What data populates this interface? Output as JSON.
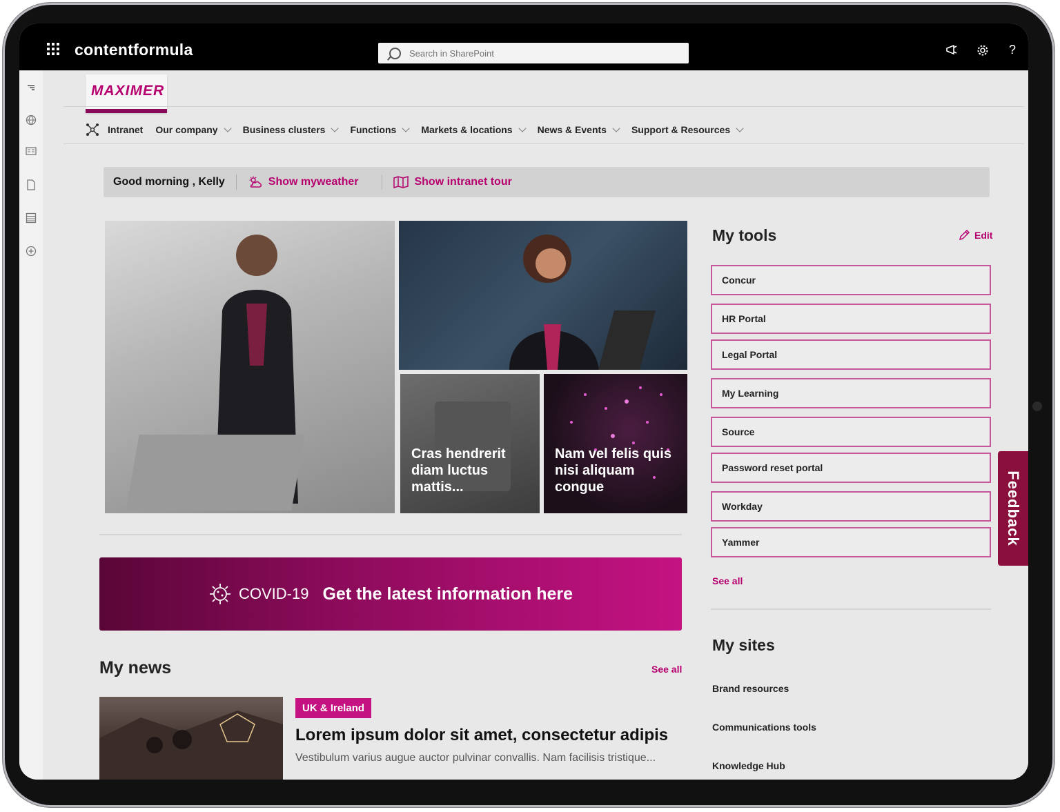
{
  "suitebar": {
    "brand": "contentformula",
    "search_placeholder": "Search in SharePoint"
  },
  "logo": {
    "text": "MAXIMER"
  },
  "nav": {
    "items": [
      {
        "label": "Intranet"
      },
      {
        "label": "Our company"
      },
      {
        "label": "Business clusters"
      },
      {
        "label": "Functions"
      },
      {
        "label": "Markets & locations"
      },
      {
        "label": "News & Events"
      },
      {
        "label": "Support & Resources"
      }
    ]
  },
  "greeting": {
    "text": "Good morning , Kelly",
    "weather_link": "Show myweather",
    "tour_link": "Show intranet tour"
  },
  "hero": {
    "tiles": [
      {
        "caption": ""
      },
      {
        "caption": ""
      },
      {
        "caption": "Cras hendrerit diam luctus mattis..."
      },
      {
        "caption": "Nam vel felis quis nisi aliquam congue"
      }
    ]
  },
  "covid": {
    "tag": "COVID-19",
    "text": "Get the latest information here"
  },
  "news": {
    "title": "My news",
    "see_all": "See all",
    "items": [
      {
        "tag": "UK & Ireland",
        "headline": "Lorem ipsum dolor sit amet, consectetur adipis",
        "excerpt": "Vestibulum varius augue auctor pulvinar convallis. Nam facilisis tristique..."
      }
    ]
  },
  "tools": {
    "title": "My tools",
    "edit_label": "Edit",
    "items": [
      {
        "label": "Concur"
      },
      {
        "label": "HR Portal"
      },
      {
        "label": "Legal Portal"
      },
      {
        "label": "My Learning"
      },
      {
        "label": "Source"
      },
      {
        "label": "Password reset portal"
      },
      {
        "label": "Workday"
      },
      {
        "label": "Yammer"
      }
    ],
    "see_all": "See all"
  },
  "sites": {
    "title": "My sites",
    "items": [
      {
        "label": "Brand resources"
      },
      {
        "label": "Communications tools"
      },
      {
        "label": "Knowledge Hub"
      }
    ]
  },
  "feedback": {
    "label": "Feedback"
  },
  "colors": {
    "accent": "#b5006e",
    "feedback_bg": "#8a0f3c",
    "suitebar_bg": "#000000"
  }
}
